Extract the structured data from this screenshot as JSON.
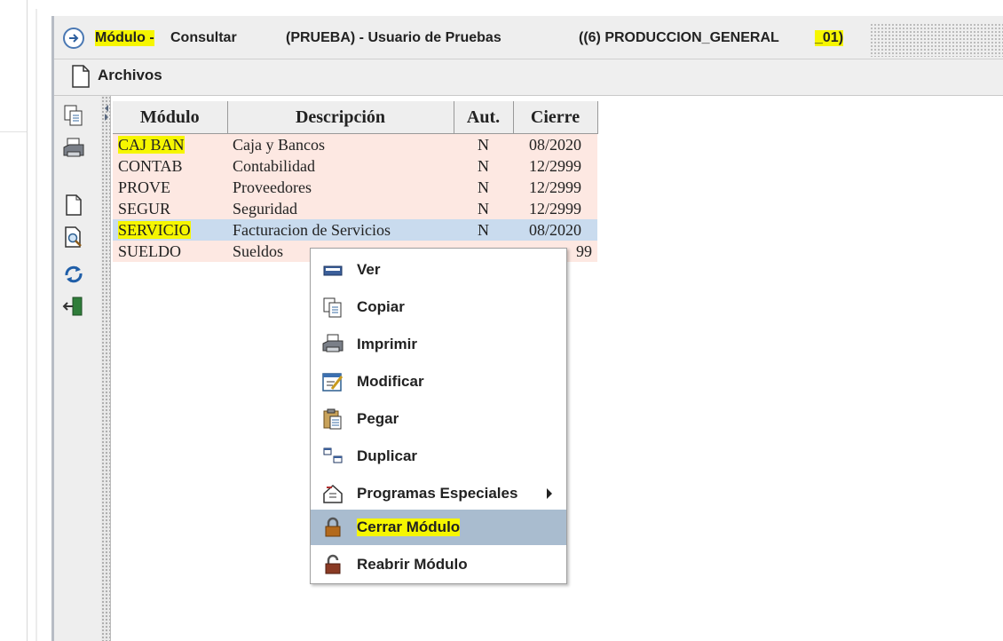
{
  "window": {
    "module_part": "Módulo -",
    "action": "Consultar",
    "context": "(PRUEBA) - Usuario de Pruebas",
    "company": "((6) PRODUCCION_GENERAL",
    "company_suffix": "_01)"
  },
  "menubar": {
    "archivos": "Archivos"
  },
  "toolbar": [
    "copy-icon",
    "print-icon",
    "new-document-icon",
    "preview-icon",
    "refresh-icon",
    "exit-icon"
  ],
  "table": {
    "columns": [
      "Módulo",
      "Descripción",
      "Aut.",
      "Cierre"
    ],
    "rows": [
      {
        "modulo": "CAJ BAN",
        "descripcion": "Caja y Bancos",
        "aut": "N",
        "cierre": "08/2020"
      },
      {
        "modulo": "CONTAB",
        "descripcion": "Contabilidad",
        "aut": "N",
        "cierre": "12/2999"
      },
      {
        "modulo": "PROVE",
        "descripcion": "Proveedores",
        "aut": "N",
        "cierre": "12/2999"
      },
      {
        "modulo": "SEGUR",
        "descripcion": "Seguridad",
        "aut": "N",
        "cierre": "12/2999"
      },
      {
        "modulo": "SERVICIO",
        "descripcion": "Facturacion de Servicios",
        "aut": "N",
        "cierre": "08/2020"
      },
      {
        "modulo": "SUELDO",
        "descripcion": "Sueldos",
        "aut": "",
        "cierre": "99"
      }
    ]
  },
  "context_menu": [
    {
      "label": "Ver",
      "icon": "view-icon"
    },
    {
      "label": "Copiar",
      "icon": "copy-icon"
    },
    {
      "label": "Imprimir",
      "icon": "print-icon"
    },
    {
      "label": "Modificar",
      "icon": "edit-icon"
    },
    {
      "label": "Pegar",
      "icon": "paste-icon"
    },
    {
      "label": "Duplicar",
      "icon": "duplicate-icon"
    },
    {
      "label": "Programas Especiales",
      "icon": "special-programs-icon"
    },
    {
      "label": "Cerrar Módulo",
      "icon": "lock-icon"
    },
    {
      "label": "Reabrir Módulo",
      "icon": "unlock-icon"
    }
  ],
  "colors": {
    "highlight": "#f6f600",
    "row_bg": "#fde8e2",
    "selected_row_bg": "#c9dbee",
    "menu_active_bg": "#a9bccf"
  }
}
